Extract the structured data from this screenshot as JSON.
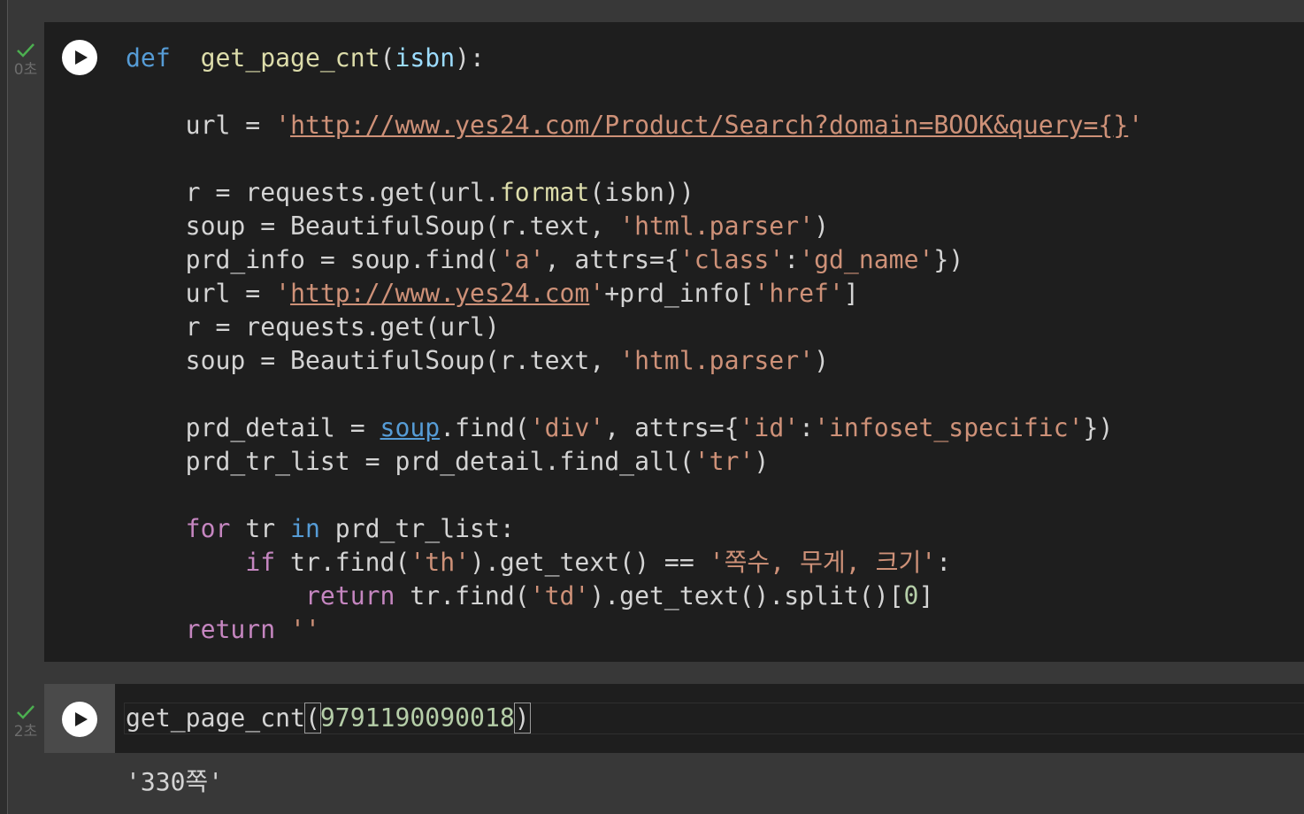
{
  "cells": [
    {
      "exec_time": "0초",
      "run_label": "run",
      "code_lines": [
        [
          [
            "kw",
            "def"
          ],
          [
            "",
            "  "
          ],
          [
            "fn",
            "get_page_cnt"
          ],
          [
            "",
            "("
          ],
          [
            "pm",
            "isbn"
          ],
          [
            "",
            "):"
          ]
        ],
        [],
        [
          [
            "",
            "    url = "
          ],
          [
            "st",
            "'"
          ],
          [
            "lk",
            "http://www.yes24.com/Product/Search?domain=BOOK&query={}"
          ],
          [
            "st",
            "'"
          ]
        ],
        [],
        [
          [
            "",
            "    r = requests.get(url."
          ],
          [
            "fn",
            "format"
          ],
          [
            "",
            "(isbn))"
          ]
        ],
        [
          [
            "",
            "    soup = BeautifulSoup(r.text, "
          ],
          [
            "st",
            "'html.parser'"
          ],
          [
            "",
            ")"
          ]
        ],
        [
          [
            "",
            "    prd_info = soup.find("
          ],
          [
            "st",
            "'a'"
          ],
          [
            "",
            ", attrs={"
          ],
          [
            "st",
            "'class'"
          ],
          [
            "",
            ":"
          ],
          [
            "st",
            "'gd_name'"
          ],
          [
            "",
            "})"
          ]
        ],
        [
          [
            "",
            "    url = "
          ],
          [
            "st",
            "'"
          ],
          [
            "lk",
            "http://www.yes24.com"
          ],
          [
            "st",
            "'"
          ],
          [
            "",
            "+prd_info["
          ],
          [
            "st",
            "'href'"
          ],
          [
            "",
            "]"
          ]
        ],
        [
          [
            "",
            "    r = requests.get(url)"
          ]
        ],
        [
          [
            "",
            "    soup = BeautifulSoup(r.text, "
          ],
          [
            "st",
            "'html.parser'"
          ],
          [
            "",
            ")"
          ]
        ],
        [],
        [
          [
            "",
            "    prd_detail = "
          ],
          [
            "ul",
            "soup"
          ],
          [
            "",
            ".find("
          ],
          [
            "st",
            "'div'"
          ],
          [
            "",
            ", attrs={"
          ],
          [
            "st",
            "'id'"
          ],
          [
            "",
            ":"
          ],
          [
            "st",
            "'infoset_specific'"
          ],
          [
            "",
            "})"
          ]
        ],
        [
          [
            "",
            "    prd_tr_list = prd_detail.find_all("
          ],
          [
            "st",
            "'tr'"
          ],
          [
            "",
            ")"
          ]
        ],
        [],
        [
          [
            "",
            "    "
          ],
          [
            "kw2",
            "for"
          ],
          [
            "",
            " tr "
          ],
          [
            "kw",
            "in"
          ],
          [
            "",
            " prd_tr_list:"
          ]
        ],
        [
          [
            "",
            "        "
          ],
          [
            "kw2",
            "if"
          ],
          [
            "",
            " tr.find("
          ],
          [
            "st",
            "'th'"
          ],
          [
            "",
            ").get_text() == "
          ],
          [
            "st",
            "'쪽수, 무게, 크기'"
          ],
          [
            "",
            ":"
          ]
        ],
        [
          [
            "",
            "            "
          ],
          [
            "kw2",
            "return"
          ],
          [
            "",
            " tr.find("
          ],
          [
            "st",
            "'td'"
          ],
          [
            "",
            ").get_text().split()["
          ],
          [
            "nm",
            "0"
          ],
          [
            "",
            "]"
          ]
        ],
        [
          [
            "",
            "    "
          ],
          [
            "kw2",
            "return"
          ],
          [
            "st",
            " ''"
          ]
        ]
      ]
    },
    {
      "exec_time": "2초",
      "run_label": "run",
      "code": {
        "fn_name": "get_page_cnt",
        "open": "(",
        "arg": "9791190090018",
        "close": ")"
      },
      "output": "'330쪽'"
    }
  ]
}
